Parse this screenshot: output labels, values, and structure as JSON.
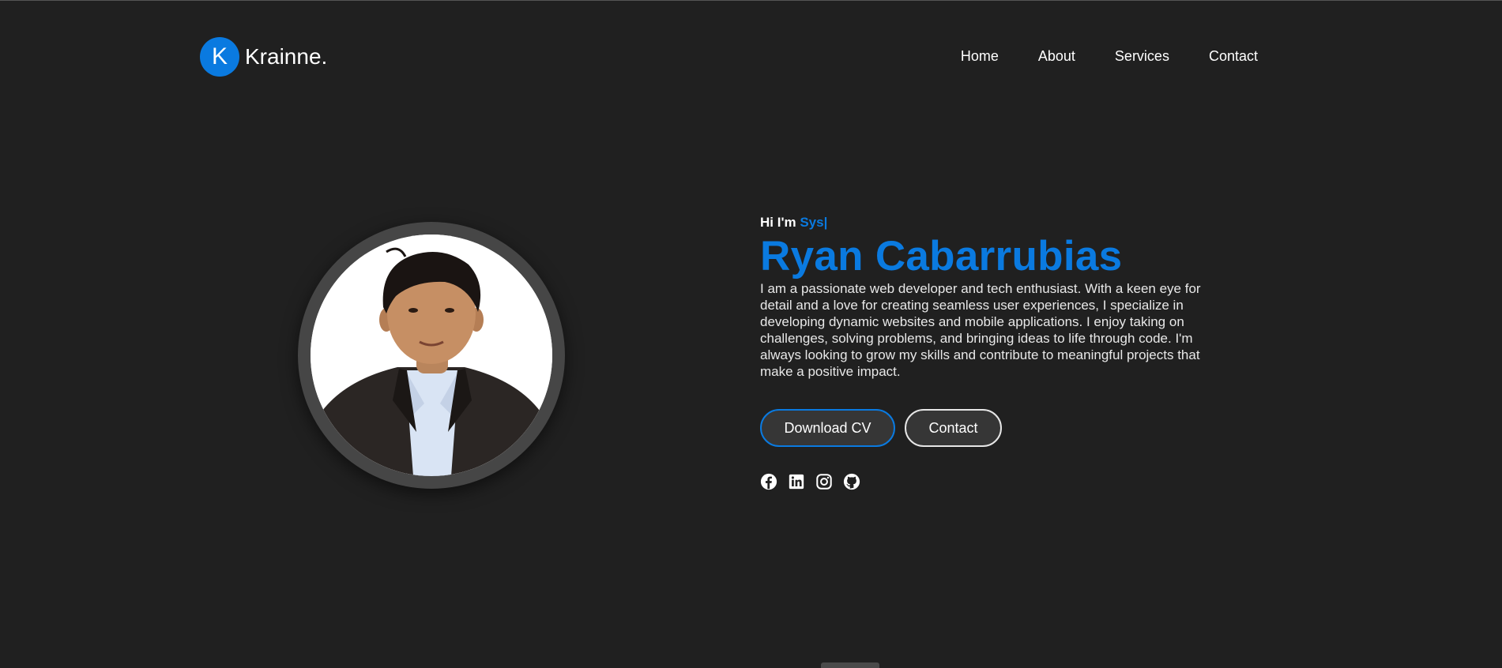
{
  "brand": {
    "initial": "K",
    "name": "Krainne."
  },
  "nav": {
    "items": [
      "Home",
      "About",
      "Services",
      "Contact"
    ]
  },
  "hero": {
    "greeting": "Hi I'm ",
    "typed_text": "Sys|",
    "name": "Ryan Cabarrubias",
    "bio": "I am a passionate web developer and tech enthusiast. With a keen eye for detail and a love for creating seamless user experiences, I specialize in developing dynamic websites and mobile applications. I enjoy taking on challenges, solving problems, and bringing ideas to life through code. I'm always looking to grow my skills and contribute to meaningful projects that make a positive impact.",
    "buttons": {
      "download": "Download CV",
      "contact": "Contact"
    },
    "socials": [
      "facebook-icon",
      "linkedin-icon",
      "instagram-icon",
      "github-icon"
    ]
  },
  "colors": {
    "background": "#202020",
    "accent": "#0a7ae0",
    "button_bg": "#363636",
    "ring": "#464646"
  }
}
